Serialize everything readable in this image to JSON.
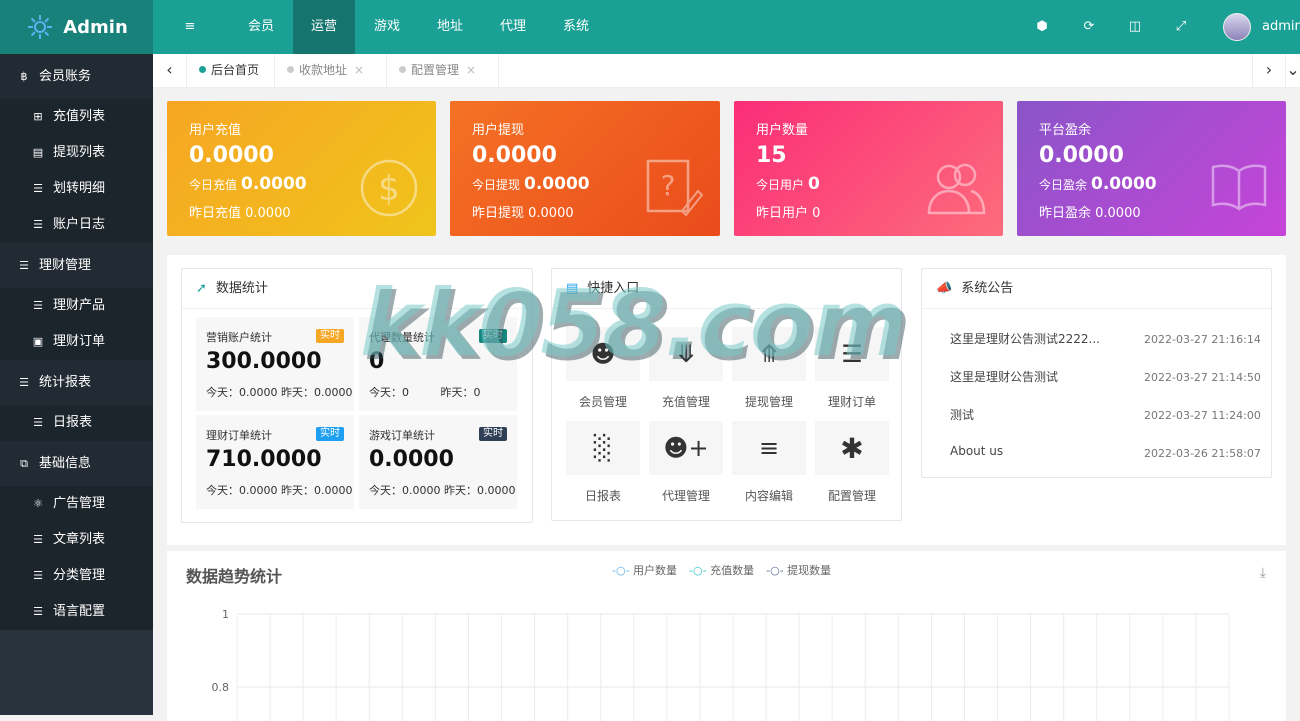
{
  "header": {
    "logo": "Admin",
    "nav": [
      "会员",
      "运营",
      "游戏",
      "地址",
      "代理",
      "系统"
    ],
    "active_nav": "运营",
    "user": "admin"
  },
  "sidebar": {
    "groups": [
      {
        "label": "会员账务",
        "icon": "bitcoin-icon",
        "items": [
          {
            "label": "充值列表",
            "icon": "plus-square-icon"
          },
          {
            "label": "提现列表",
            "icon": "chart-area-icon"
          },
          {
            "label": "划转明细",
            "icon": "list-icon"
          },
          {
            "label": "账户日志",
            "icon": "list-icon"
          }
        ]
      },
      {
        "label": "理财管理",
        "icon": "list-icon",
        "items": [
          {
            "label": "理财产品",
            "icon": "list-icon"
          },
          {
            "label": "理财订单",
            "icon": "inbox-icon"
          }
        ]
      },
      {
        "label": "统计报表",
        "icon": "list-icon",
        "items": [
          {
            "label": "日报表",
            "icon": "list-icon"
          }
        ]
      },
      {
        "label": "基础信息",
        "icon": "copy-icon",
        "items": [
          {
            "label": "广告管理",
            "icon": "ad-icon"
          },
          {
            "label": "文章列表",
            "icon": "list-icon"
          },
          {
            "label": "分类管理",
            "icon": "list-icon"
          },
          {
            "label": "语言配置",
            "icon": "list-icon"
          }
        ]
      }
    ]
  },
  "tabs": [
    {
      "label": "后台首页",
      "active": true
    },
    {
      "label": "收款地址",
      "active": false
    },
    {
      "label": "配置管理",
      "active": false
    }
  ],
  "cards": [
    {
      "title": "用户充值",
      "value": "0.0000",
      "today_label": "今日充值",
      "today": "0.0000",
      "yesterday": "昨日充值 0.0000",
      "icon": "dollar-icon",
      "color1": "#f6a623",
      "color2": "#f0c41b"
    },
    {
      "title": "用户提现",
      "value": "0.0000",
      "today_label": "今日提现",
      "today": "0.0000",
      "yesterday": "昨日提现 0.0000",
      "icon": "help-edit-icon",
      "color1": "#f57224",
      "color2": "#ea4b1c"
    },
    {
      "title": "用户数量",
      "value": "15",
      "today_label": "今日用户",
      "today": "0",
      "yesterday": "昨日用户 0",
      "icon": "users-icon",
      "color1": "#fb2d77",
      "color2": "#fd6c7c"
    },
    {
      "title": "平台盈余",
      "value": "0.0000",
      "today_label": "今日盈余",
      "today": "0.0000",
      "yesterday": "昨日盈余 0.0000",
      "icon": "book-icon",
      "color1": "#8a55c8",
      "color2": "#c644d9"
    }
  ],
  "stats_panel": {
    "title": "数据统计",
    "items": [
      {
        "label": "营销账户统计",
        "tag": "实时",
        "tag_color": "#f5a623",
        "value": "300.0000",
        "footer": "今天：0.0000 昨天：0.0000"
      },
      {
        "label": "代理数量统计",
        "tag": "实时",
        "tag_color": "#16867e",
        "value": "0",
        "footer": "今天：0         昨天：0"
      },
      {
        "label": "理财订单统计",
        "tag": "实时",
        "tag_color": "#1e9ff2",
        "value": "710.0000",
        "footer": "今天：0.0000 昨天：0.0000"
      },
      {
        "label": "游戏订单统计",
        "tag": "实时",
        "tag_color": "#2f4056",
        "value": "0.0000",
        "footer": "今天：0.0000 昨天：0.0000"
      }
    ]
  },
  "quick_panel": {
    "title": "快捷入口",
    "items": [
      {
        "label": "会员管理",
        "icon": "user-icon"
      },
      {
        "label": "充值管理",
        "icon": "download-circle-icon"
      },
      {
        "label": "提现管理",
        "icon": "upload-circle-icon"
      },
      {
        "label": "理财订单",
        "icon": "list-icon"
      },
      {
        "label": "日报表",
        "icon": "bar-chart-icon"
      },
      {
        "label": "代理管理",
        "icon": "user-plus-icon"
      },
      {
        "label": "内容编辑",
        "icon": "menu-icon"
      },
      {
        "label": "配置管理",
        "icon": "asterisk-icon"
      }
    ]
  },
  "notice_panel": {
    "title": "系统公告",
    "items": [
      {
        "title": "这里是理财公告测试2222...",
        "date": "2022-03-27 21:16:14"
      },
      {
        "title": "这里是理财公告测试",
        "date": "2022-03-27 21:14:50"
      },
      {
        "title": "测试",
        "date": "2022-03-27 11:24:00"
      },
      {
        "title": "About us",
        "date": "2022-03-26 21:58:07"
      }
    ]
  },
  "trend": {
    "title": "数据趋势统计",
    "legend": [
      "用户数量",
      "充值数量",
      "提现数量"
    ],
    "legend_colors": [
      "#5ab1ef",
      "#2ec7c9",
      "#5b6e96"
    ],
    "y_ticks": [
      "1",
      "0.8"
    ]
  },
  "watermark": "kk058.com"
}
